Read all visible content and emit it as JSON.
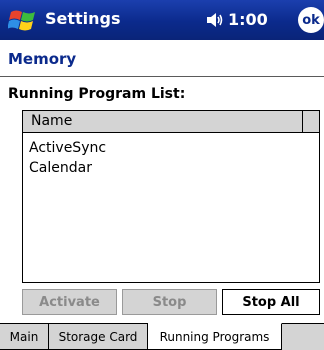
{
  "titlebar": {
    "app_title": "Settings",
    "time": "1:00",
    "ok_label": "ok"
  },
  "page": {
    "title": "Memory",
    "section_label": "Running Program List:"
  },
  "list": {
    "columns": [
      "Name"
    ],
    "rows": [
      "ActiveSync",
      "Calendar"
    ]
  },
  "buttons": {
    "activate": "Activate",
    "stop": "Stop",
    "stop_all": "Stop All"
  },
  "tabs": [
    "Main",
    "Storage Card",
    "Running Programs"
  ],
  "active_tab": "Running Programs",
  "colors": {
    "titlebar": "#0b2a8c",
    "heading": "#0b2a8c",
    "chrome": "#d4d4d4"
  },
  "icons": [
    "windows-start-icon",
    "speaker-icon"
  ]
}
